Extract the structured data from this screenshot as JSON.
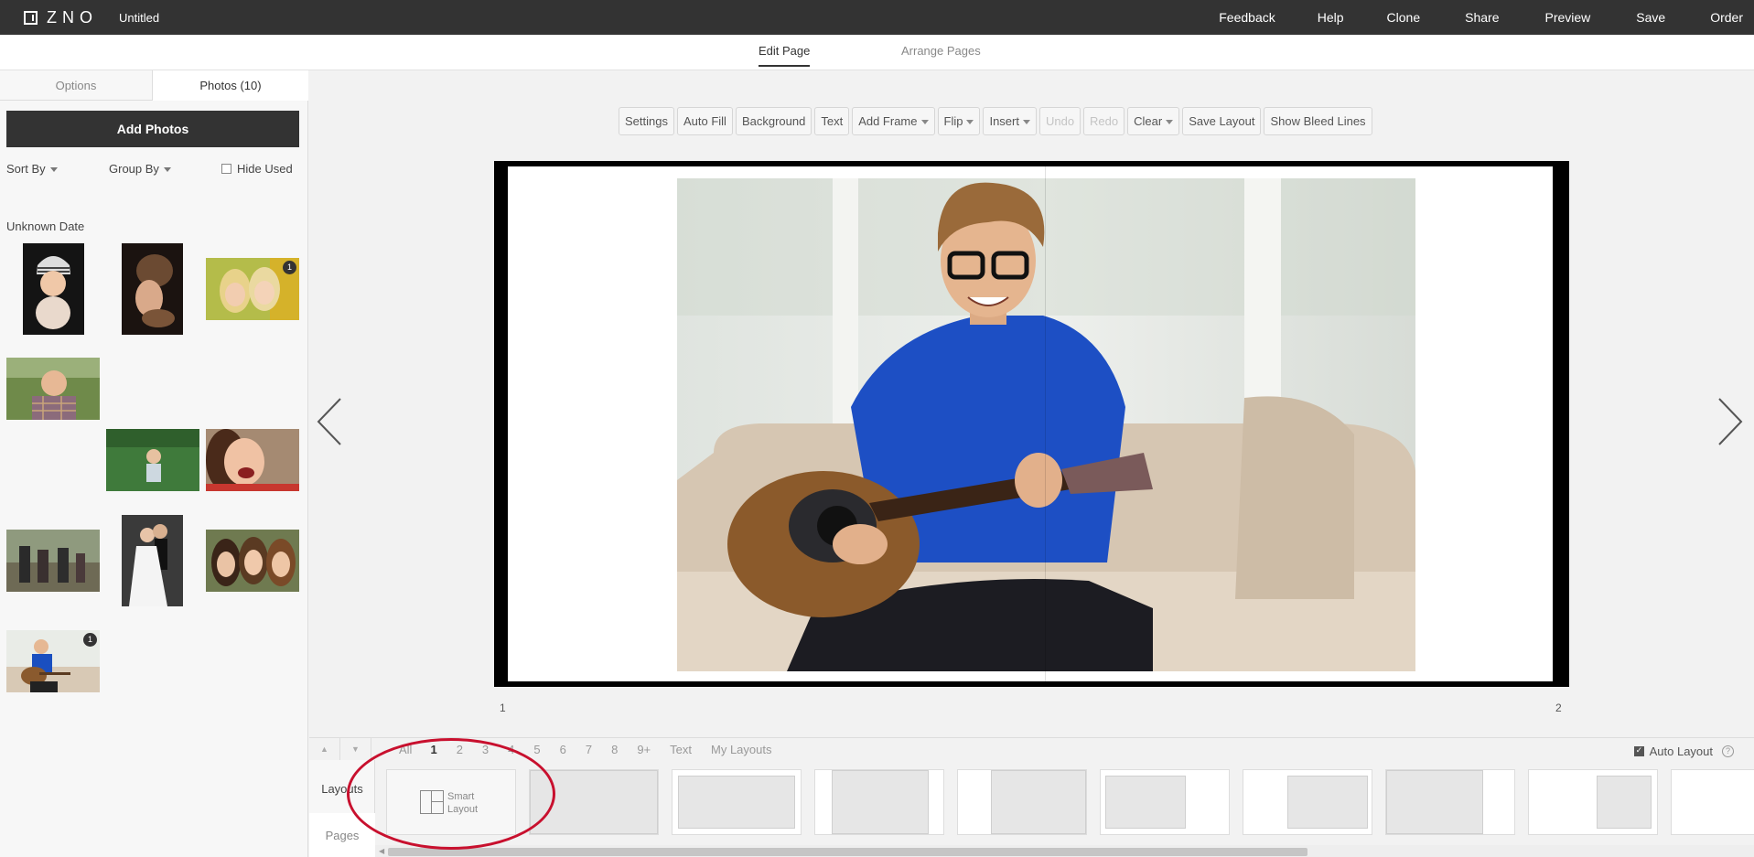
{
  "app": {
    "logo": "ZNO",
    "document_title": "Untitled"
  },
  "topnav": [
    "Feedback",
    "Help",
    "Clone",
    "Share",
    "Preview",
    "Save",
    "Order"
  ],
  "subtabs": {
    "edit": "Edit Page",
    "arrange": "Arrange Pages"
  },
  "sidebar": {
    "tab_options": "Options",
    "tab_photos": "Photos (10)",
    "add_photos": "Add Photos",
    "sort_by": "Sort By",
    "group_by": "Group By",
    "hide_used": "Hide Used",
    "group_label": "Unknown Date",
    "photos": [
      {
        "subject": "baby-striped-hat",
        "badge": ""
      },
      {
        "subject": "newborn-knit-hat",
        "badge": ""
      },
      {
        "subject": "two-girls-smiling",
        "badge": "1"
      },
      {
        "subject": "boy-plaid-shirt",
        "badge": ""
      },
      {
        "subject": "child-on-grass",
        "badge": ""
      },
      {
        "subject": "girl-laughing",
        "badge": ""
      },
      {
        "subject": "family-outdoors",
        "badge": ""
      },
      {
        "subject": "wedding-couple",
        "badge": ""
      },
      {
        "subject": "three-women-smiling",
        "badge": ""
      },
      {
        "subject": "man-with-guitar",
        "badge": "1"
      }
    ]
  },
  "toolbar": {
    "settings": "Settings",
    "auto_fill": "Auto Fill",
    "background": "Background",
    "text": "Text",
    "add_frame": "Add Frame",
    "flip": "Flip",
    "insert": "Insert",
    "undo": "Undo",
    "redo": "Redo",
    "clear": "Clear",
    "save_layout": "Save Layout",
    "show_bleed": "Show Bleed Lines"
  },
  "canvas": {
    "page_left": "1",
    "page_right": "2",
    "photo_subject": "young man with glasses playing acoustic guitar on sofa"
  },
  "bottom": {
    "side_layouts": "Layouts",
    "side_pages": "Pages",
    "filters": [
      "All",
      "1",
      "2",
      "3",
      "4",
      "5",
      "6",
      "7",
      "8",
      "9+",
      "Text",
      "My Layouts"
    ],
    "active_filter": "1",
    "auto_layout": "Auto Layout",
    "auto_layout_checked": true,
    "smart_layout_line1": "Smart",
    "smart_layout_line2": "Layout"
  },
  "colors": {
    "topbar": "#333333",
    "annotation_circle": "#c8102e"
  }
}
